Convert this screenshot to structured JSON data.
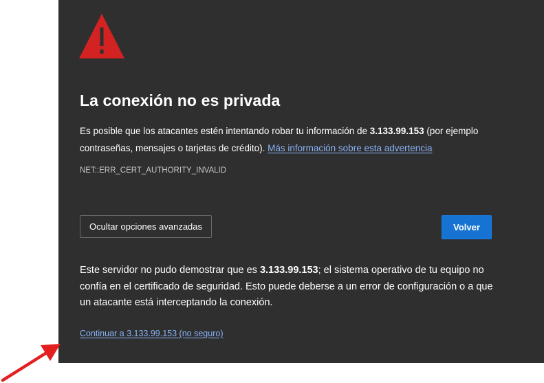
{
  "warning": {
    "icon": "warning-triangle-icon",
    "color": "#d32222"
  },
  "title": "La conexión no es privada",
  "intro": {
    "text_before": "Es posible que los atacantes estén intentando robar tu información de ",
    "host": "3.133.99.153",
    "text_after": " (por ejemplo contraseñas, mensajes o tarjetas de crédito). ",
    "learn_more_link": "Más información sobre esta advertencia"
  },
  "error_code": "NET::ERR_CERT_AUTHORITY_INVALID",
  "buttons": {
    "advanced_label": "Ocultar opciones avanzadas",
    "back_label": "Volver"
  },
  "advanced_details": {
    "text_before": "Este servidor no pudo demostrar que es ",
    "host": "3.133.99.153",
    "text_after": "; el sistema operativo de tu equipo no confía en el certificado de seguridad. Esto puede deberse a un error de configuración o a que un atacante está interceptando la conexión."
  },
  "continue_link": "Continuar a 3.133.99.153 (no seguro)",
  "annotation": {
    "icon": "red-arrow-icon",
    "color": "#e3201f"
  },
  "colors": {
    "panel_background": "#2f2f30",
    "link": "#8ab4f8",
    "primary_button": "#1673d1"
  }
}
